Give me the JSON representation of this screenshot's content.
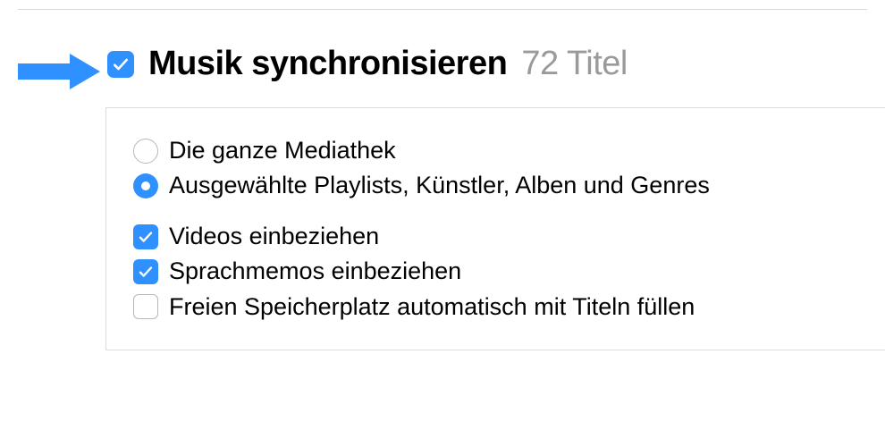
{
  "colors": {
    "accent": "#2f90ff",
    "muted": "#9a9a9a"
  },
  "header": {
    "sync_music_label": "Musik synchronisieren",
    "count_label": "72 Titel",
    "checked": true
  },
  "options": {
    "radio_entire_library_label": "Die ganze Mediathek",
    "radio_selected_items_label": "Ausgewählte Playlists, Künstler, Alben und Genres",
    "selected_radio": "selected_items",
    "include_videos_label": "Videos einbeziehen",
    "include_videos_checked": true,
    "include_voice_memos_label": "Sprachmemos einbeziehen",
    "include_voice_memos_checked": true,
    "autofill_free_space_label": "Freien Speicherplatz automatisch mit Titeln füllen",
    "autofill_free_space_checked": false
  }
}
